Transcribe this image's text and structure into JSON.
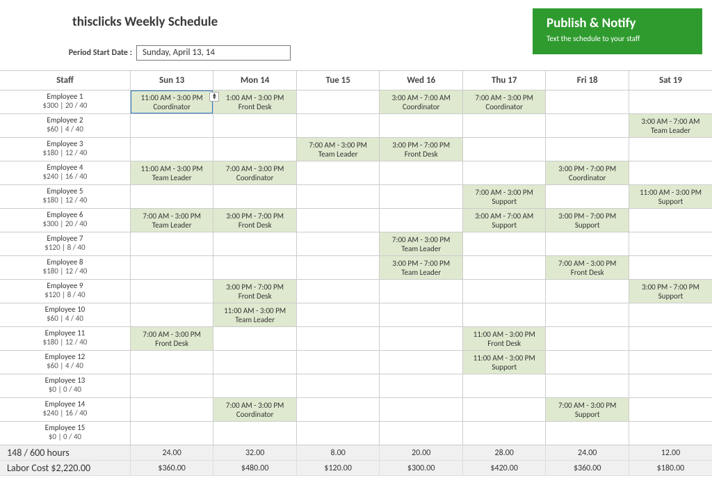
{
  "title": "thisclicks Weekly Schedule",
  "period_label": "Period Start Date :",
  "period_value": "Sunday, April 13, 14",
  "publish": {
    "title": "Publish & Notify",
    "sub": "Text the schedule to your staff"
  },
  "cols": {
    "staff": "Staff",
    "d0": "Sun 13",
    "d1": "Mon 14",
    "d2": "Tue 15",
    "d3": "Wed 16",
    "d4": "Thu 17",
    "d5": "Fri 18",
    "d6": "Sat 19"
  },
  "rows": [
    {
      "name": "Employee 1",
      "stats": "$300 | 20 / 40",
      "shifts": [
        {
          "time": "11:00 AM - 3:00 PM",
          "role": "Coordinator"
        },
        {
          "time": "1:00 AM - 3:00 PM",
          "role": "Front Desk"
        },
        null,
        {
          "time": "3:00 AM - 7:00 AM",
          "role": "Coordinator"
        },
        {
          "time": "7:00 AM - 3:00 PM",
          "role": "Coordinator"
        },
        null,
        null
      ]
    },
    {
      "name": "Employee 2",
      "stats": "$60 | 4 / 40",
      "shifts": [
        null,
        null,
        null,
        null,
        null,
        null,
        {
          "time": "3:00 AM - 7:00 AM",
          "role": "Team Leader"
        }
      ]
    },
    {
      "name": "Employee 3",
      "stats": "$180 | 12 / 40",
      "shifts": [
        null,
        null,
        {
          "time": "7:00 AM - 3:00 PM",
          "role": "Team Leader"
        },
        {
          "time": "3:00 PM - 7:00 PM",
          "role": "Front Desk"
        },
        null,
        null,
        null
      ]
    },
    {
      "name": "Employee 4",
      "stats": "$240 | 16 / 40",
      "shifts": [
        {
          "time": "11:00 AM - 3:00 PM",
          "role": "Team Leader"
        },
        {
          "time": "7:00 AM - 3:00 PM",
          "role": "Coordinator"
        },
        null,
        null,
        null,
        {
          "time": "3:00 PM - 7:00 PM",
          "role": "Coordinator"
        },
        null
      ]
    },
    {
      "name": "Employee 5",
      "stats": "$180 | 12 / 40",
      "shifts": [
        null,
        null,
        null,
        null,
        {
          "time": "7:00 AM - 3:00 PM",
          "role": "Support"
        },
        null,
        {
          "time": "11:00 AM - 3:00 PM",
          "role": "Support"
        }
      ]
    },
    {
      "name": "Employee 6",
      "stats": "$300 | 20 / 40",
      "shifts": [
        {
          "time": "7:00 AM - 3:00 PM",
          "role": "Team Leader"
        },
        {
          "time": "3:00 PM - 7:00 PM",
          "role": "Front Desk"
        },
        null,
        null,
        {
          "time": "3:00 AM - 7:00 AM",
          "role": "Support"
        },
        {
          "time": "3:00 PM - 7:00 PM",
          "role": "Support"
        },
        null
      ]
    },
    {
      "name": "Employee 7",
      "stats": "$120 | 8 / 40",
      "shifts": [
        null,
        null,
        null,
        {
          "time": "7:00 AM - 3:00 PM",
          "role": "Team Leader"
        },
        null,
        null,
        null
      ]
    },
    {
      "name": "Employee 8",
      "stats": "$180 | 12 / 40",
      "shifts": [
        null,
        null,
        null,
        {
          "time": "3:00 PM - 7:00 PM",
          "role": "Team Leader"
        },
        null,
        {
          "time": "7:00 AM - 3:00 PM",
          "role": "Front Desk"
        },
        null
      ]
    },
    {
      "name": "Employee 9",
      "stats": "$120 | 8 / 40",
      "shifts": [
        null,
        {
          "time": "3:00 PM - 7:00 PM",
          "role": "Front Desk"
        },
        null,
        null,
        null,
        null,
        {
          "time": "3:00 PM - 7:00 PM",
          "role": "Support"
        }
      ]
    },
    {
      "name": "Employee 10",
      "stats": "$60 | 4 / 40",
      "shifts": [
        null,
        {
          "time": "11:00 AM - 3:00 PM",
          "role": "Team Leader"
        },
        null,
        null,
        null,
        null,
        null
      ]
    },
    {
      "name": "Employee 11",
      "stats": "$180 | 12 / 40",
      "shifts": [
        {
          "time": "7:00 AM - 3:00 PM",
          "role": "Front Desk"
        },
        null,
        null,
        null,
        {
          "time": "11:00 AM - 3:00 PM",
          "role": "Front Desk"
        },
        null,
        null
      ]
    },
    {
      "name": "Employee 12",
      "stats": "$60 | 4 / 40",
      "shifts": [
        null,
        null,
        null,
        null,
        {
          "time": "11:00 AM - 3:00 PM",
          "role": "Support"
        },
        null,
        null
      ]
    },
    {
      "name": "Employee 13",
      "stats": "$0 | 0 / 40",
      "shifts": [
        null,
        null,
        null,
        null,
        null,
        null,
        null
      ]
    },
    {
      "name": "Employee 14",
      "stats": "$240 | 16 / 40",
      "shifts": [
        null,
        {
          "time": "7:00 AM - 3:00 PM",
          "role": "Coordinator"
        },
        null,
        null,
        null,
        {
          "time": "7:00 AM - 3:00 PM",
          "role": "Support"
        },
        null
      ]
    },
    {
      "name": "Employee 15",
      "stats": "$0 | 0 / 40",
      "shifts": [
        null,
        null,
        null,
        null,
        null,
        null,
        null
      ]
    }
  ],
  "footer": {
    "hours_label": "148 / 600 hours",
    "hours": [
      "24.00",
      "32.00",
      "8.00",
      "20.00",
      "28.00",
      "24.00",
      "12.00"
    ],
    "cost_label": "Labor Cost $2,220.00",
    "costs": [
      "$360.00",
      "$480.00",
      "$120.00",
      "$300.00",
      "$420.00",
      "$360.00",
      "$180.00"
    ]
  },
  "selected": {
    "row": 0,
    "day": 0
  }
}
